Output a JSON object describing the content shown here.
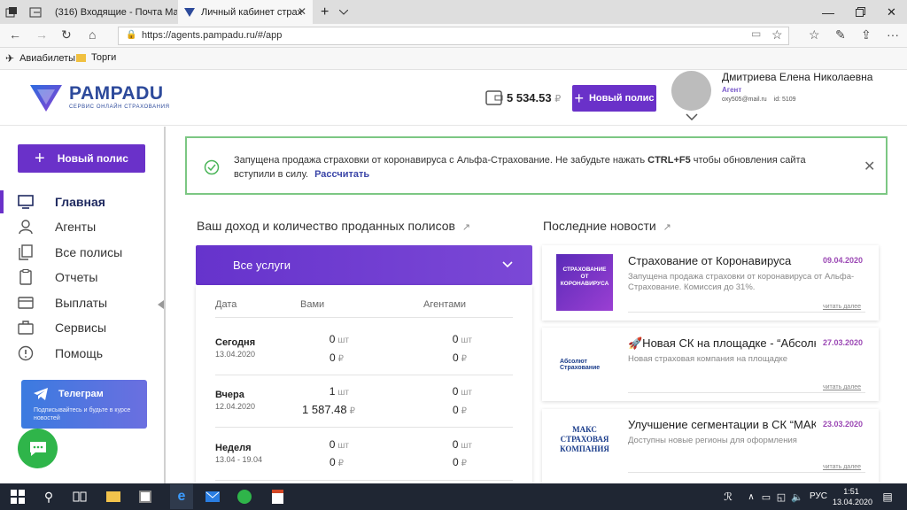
{
  "browser": {
    "tabs": [
      {
        "label": "(316) Входящие - Почта Ма"
      },
      {
        "label": "Личный кабинет страх"
      }
    ],
    "url": "https://agents.pampadu.ru/#/app",
    "favorites": [
      {
        "label": "Авиабилеты"
      },
      {
        "label": "Торги"
      }
    ]
  },
  "header": {
    "logo": "PAMPADU",
    "logo_sub": "СЕРВИС ОНЛАЙН СТРАХОВАНИЯ",
    "balance": "5 534.53",
    "currency": "₽",
    "new_policy": "Новый полис",
    "user_name": "Дмитриева Елена Николаевна",
    "user_role": "Агент",
    "user_email": "oxy505@mail.ru",
    "user_id": "id: 5109"
  },
  "sidebar": {
    "new_policy": "Новый полис",
    "items": [
      {
        "label": "Главная"
      },
      {
        "label": "Агенты"
      },
      {
        "label": "Все полисы"
      },
      {
        "label": "Отчеты"
      },
      {
        "label": "Выплаты"
      },
      {
        "label": "Сервисы"
      },
      {
        "label": "Помощь"
      }
    ],
    "telegram_title": "Телеграм",
    "telegram_desc": "Подписывайтесь и будьте в курсе новостей"
  },
  "notice": {
    "text_before": "Запущена продажа страховки от коронавируса с Альфа-Страхование. Не забудьте нажать ",
    "text_key": "CTRL+F5",
    "text_after": " чтобы обновления сайта вступили в силу.",
    "link": "Рассчитать"
  },
  "income": {
    "title": "Ваш доход и количество проданных полисов",
    "services_label": "Все услуги",
    "col_date": "Дата",
    "col_you": "Вами",
    "col_agents": "Агентами",
    "unit_count": "шт",
    "unit_money": "₽",
    "rows": [
      {
        "label": "Сегодня",
        "date": "13.04.2020",
        "you_count": "0",
        "you_money": "0",
        "ag_count": "0",
        "ag_money": "0"
      },
      {
        "label": "Вчера",
        "date": "12.04.2020",
        "you_count": "1",
        "you_money": "1 587.48",
        "ag_count": "0",
        "ag_money": "0"
      },
      {
        "label": "Неделя",
        "date": "13.04 - 19.04",
        "you_count": "0",
        "you_money": "0",
        "ag_count": "0",
        "ag_money": "0"
      }
    ]
  },
  "news": {
    "title": "Последние новости",
    "more": "читать далее",
    "items": [
      {
        "title": "Страхование от Коронавируса",
        "date": "09.04.2020",
        "desc": "Запущена продажа страховки от коронавируса от Альфа-Страхование. Комиссия до 31%.",
        "thumb_text": "СТРАХОВАНИЕ ОТ КОРОНАВИРУСА"
      },
      {
        "title": "🚀Новая СК на площадке - “Абсолют Страхование”",
        "date": "27.03.2020",
        "desc": "Новая страховая компания на площадке",
        "thumb_text": "Абсолют Страхование"
      },
      {
        "title": "Улучшение сегментации в СК “МАКС”",
        "date": "23.03.2020",
        "desc": "Доступны новые регионы для оформления",
        "thumb_text": "МАКС СТРАХОВАЯ КОМПАНИЯ"
      }
    ]
  },
  "taskbar": {
    "lang": "РУС",
    "time": "1:51",
    "date": "13.04.2020"
  },
  "colors": {
    "accent": "#6a31c9",
    "success": "#7cc783",
    "news_date": "#9b48b4"
  }
}
